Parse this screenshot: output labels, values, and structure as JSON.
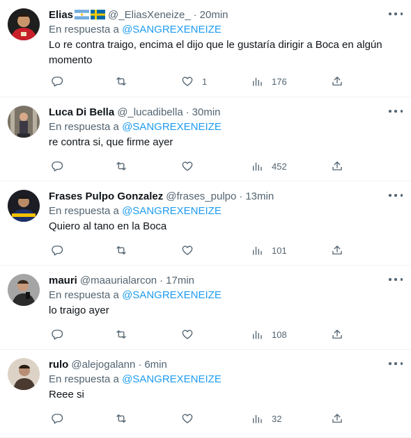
{
  "reply_prefix": "En respuesta a",
  "reply_mention": "@SANGREXENEIZE",
  "tweets": [
    {
      "display_name": "Elias",
      "flags": [
        "flag-argentina",
        "flag-sweden"
      ],
      "handle": "@_EliasXeneize_",
      "dot": "·",
      "time": "20min",
      "text": "Lo re contra traigo, encima el dijo que le gustaría dirigir a Boca en algún momento",
      "replies": "",
      "retweets": "",
      "likes": "1",
      "views": "176",
      "avatar_colors": {
        "bg": "#8b1a1a",
        "accent": "#d22d2d"
      }
    },
    {
      "display_name": "Luca Di Bella",
      "handle": "@_lucadibella",
      "dot": "·",
      "time": "30min",
      "text": "re contra si, que firme ayer",
      "replies": "",
      "retweets": "",
      "likes": "",
      "views": "452",
      "avatar_colors": {
        "bg": "#6b6458",
        "accent": "#a8a090"
      }
    },
    {
      "display_name": "Frases Pulpo Gonzalez",
      "handle": "@frases_pulpo",
      "dot": "·",
      "time": "13min",
      "text": "Quiero al tano en la Boca",
      "replies": "",
      "retweets": "",
      "likes": "",
      "views": "101",
      "avatar_colors": {
        "bg": "#1b2f6b",
        "accent": "#f2c200"
      }
    },
    {
      "display_name": "mauri",
      "handle": "@maaurialarcon",
      "dot": "·",
      "time": "17min",
      "text": "lo traigo ayer",
      "replies": "",
      "retweets": "",
      "likes": "",
      "views": "108",
      "avatar_colors": {
        "bg": "#9a9a9a",
        "accent": "#2b2b2b"
      }
    },
    {
      "display_name": "rulo",
      "handle": "@alejogalann",
      "dot": "·",
      "time": "6min",
      "text": "Reee si",
      "replies": "",
      "retweets": "",
      "likes": "",
      "views": "32",
      "avatar_colors": {
        "bg": "#d9cfc4",
        "accent": "#4a3a2f"
      }
    }
  ],
  "icons": {
    "reply": "reply-icon",
    "retweet": "retweet-icon",
    "like": "like-icon",
    "views": "views-icon",
    "share": "share-icon",
    "more": "more-icon"
  },
  "colors": {
    "mention": "#1d9bf0",
    "secondary_text": "#536471",
    "primary_text": "#0f1419",
    "divider": "#eff3f4"
  }
}
